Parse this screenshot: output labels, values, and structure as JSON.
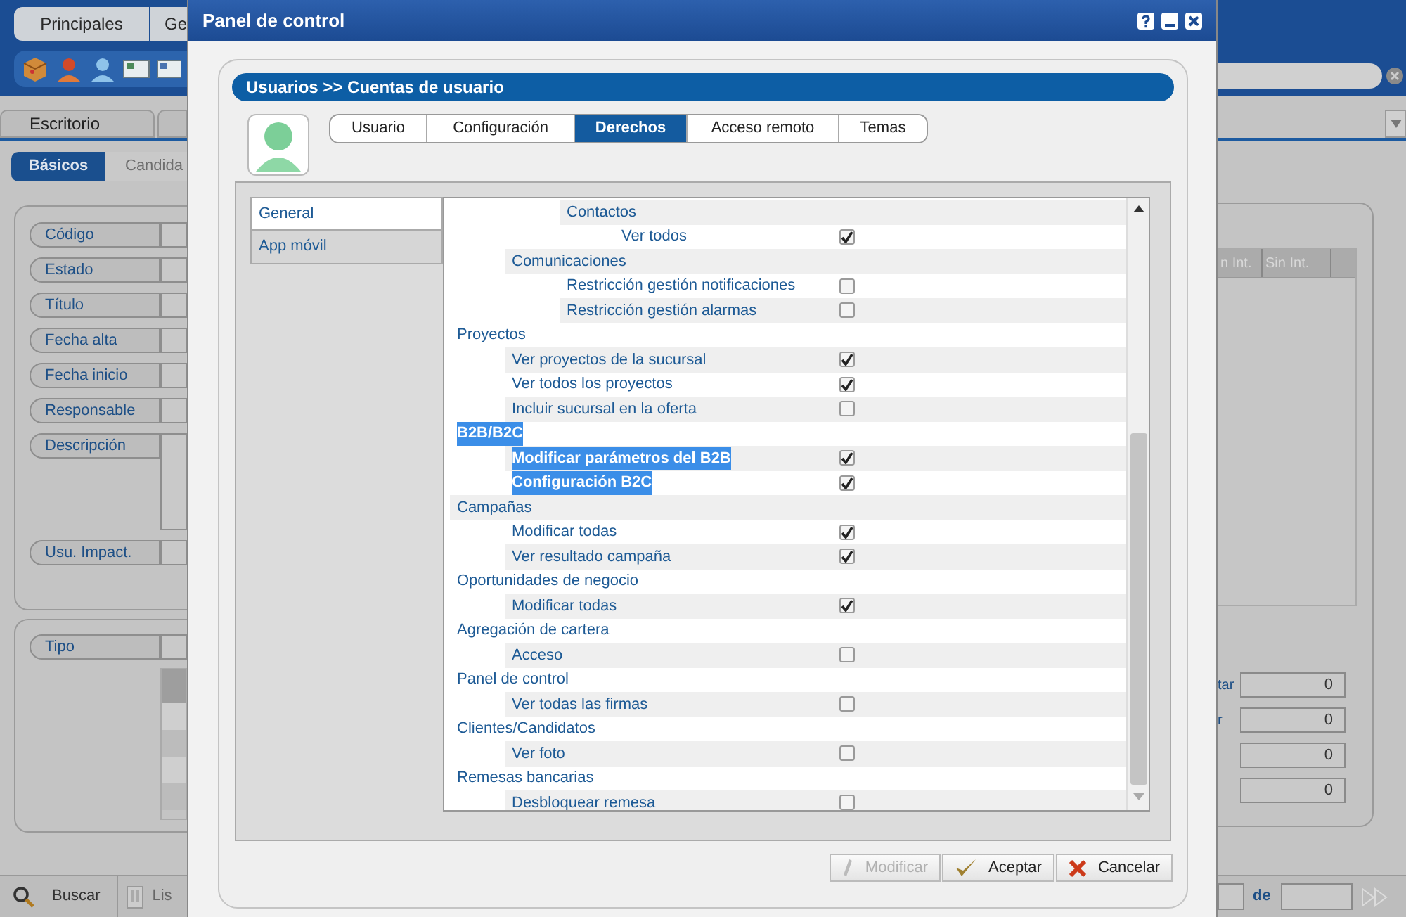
{
  "background_app": {
    "main_menu": [
      "Principales",
      "Ge"
    ],
    "tabs": [
      {
        "label": "Escritorio"
      }
    ],
    "subtabs": [
      {
        "label": "Básicos",
        "selected": true
      },
      {
        "label": "Candida",
        "selected": false
      }
    ],
    "form_fields": [
      {
        "label": "Código",
        "kind": "line"
      },
      {
        "label": "Estado",
        "kind": "line"
      },
      {
        "label": "Título",
        "kind": "line"
      },
      {
        "label": "Fecha alta",
        "kind": "line"
      },
      {
        "label": "Fecha inicio",
        "kind": "line"
      },
      {
        "label": "Responsable",
        "kind": "line"
      },
      {
        "label": "Descripción",
        "kind": "area"
      },
      {
        "label": "Usu. Impact.",
        "kind": "line"
      }
    ],
    "type_label": "Tipo",
    "bottom_bar": [
      "Buscar",
      "Lis"
    ],
    "table_columns": [
      "n Int.",
      "Sin Int."
    ],
    "counters": [
      {
        "label": "tar",
        "value": "0"
      },
      {
        "label": "r",
        "value": "0"
      },
      {
        "value": "0"
      },
      {
        "value": "0"
      }
    ],
    "pager_label": "de"
  },
  "dialog": {
    "title": "Panel de control",
    "breadcrumb": "Usuarios >> Cuentas de usuario",
    "tabs": [
      {
        "label": "Usuario",
        "selected": false
      },
      {
        "label": "Configuración",
        "selected": false
      },
      {
        "label": "Derechos",
        "selected": true
      },
      {
        "label": "Acceso remoto",
        "selected": false
      },
      {
        "label": "Temas",
        "selected": false
      }
    ],
    "sections": [
      {
        "label": "General",
        "selected": true
      },
      {
        "label": "App móvil",
        "selected": false
      }
    ],
    "tree": [
      {
        "children": [
          {
            "children": [
              {
                "label": "Contactos",
                "selected": false,
                "children": [
                  {
                    "label": "Ver todos",
                    "selected": false,
                    "checked": true
                  }
                ]
              }
            ]
          },
          {
            "label": "Comunicaciones",
            "selected": false,
            "children": [
              {
                "label": "Restricción gestión notificaciones",
                "selected": false,
                "checked": false
              },
              {
                "label": "Restricción gestión alarmas",
                "selected": false,
                "checked": false
              }
            ]
          }
        ]
      },
      {
        "label": "Proyectos",
        "selected": false,
        "children": [
          {
            "label": "Ver proyectos de la sucursal",
            "selected": false,
            "checked": true
          },
          {
            "label": "Ver todos los proyectos",
            "selected": false,
            "checked": true
          },
          {
            "label": "Incluir sucursal en la oferta",
            "selected": false,
            "checked": false
          }
        ]
      },
      {
        "label": "B2B/B2C",
        "selected": true,
        "children": [
          {
            "label": "Modificar parámetros del B2B",
            "selected": true,
            "checked": true
          },
          {
            "label": "Configuración B2C",
            "selected": true,
            "checked": true
          }
        ]
      },
      {
        "label": "Campañas",
        "selected": false,
        "children": [
          {
            "label": "Modificar todas",
            "selected": false,
            "checked": true
          },
          {
            "label": "Ver resultado campaña",
            "selected": false,
            "checked": true
          }
        ]
      },
      {
        "label": "Oportunidades de negocio",
        "selected": false,
        "children": [
          {
            "label": "Modificar todas",
            "selected": false,
            "checked": true
          }
        ]
      },
      {
        "label": "Agregación de cartera",
        "selected": false,
        "children": [
          {
            "label": "Acceso",
            "selected": false,
            "checked": false
          }
        ]
      },
      {
        "label": "Panel de control",
        "selected": false,
        "children": [
          {
            "label": "Ver todas las firmas",
            "selected": false,
            "checked": false
          }
        ]
      },
      {
        "label": "Clientes/Candidatos",
        "selected": false,
        "children": [
          {
            "label": "Ver foto",
            "selected": false,
            "checked": false
          }
        ]
      },
      {
        "label": "Remesas bancarias",
        "selected": false,
        "children": [
          {
            "label": "Desbloquear remesa",
            "selected": false,
            "checked": false
          }
        ]
      }
    ],
    "buttons": [
      {
        "label": "Modificar",
        "kind": "edit",
        "disabled": true
      },
      {
        "label": "Aceptar",
        "kind": "accept",
        "disabled": false
      },
      {
        "label": "Cancelar",
        "kind": "cancel",
        "disabled": false
      }
    ]
  }
}
